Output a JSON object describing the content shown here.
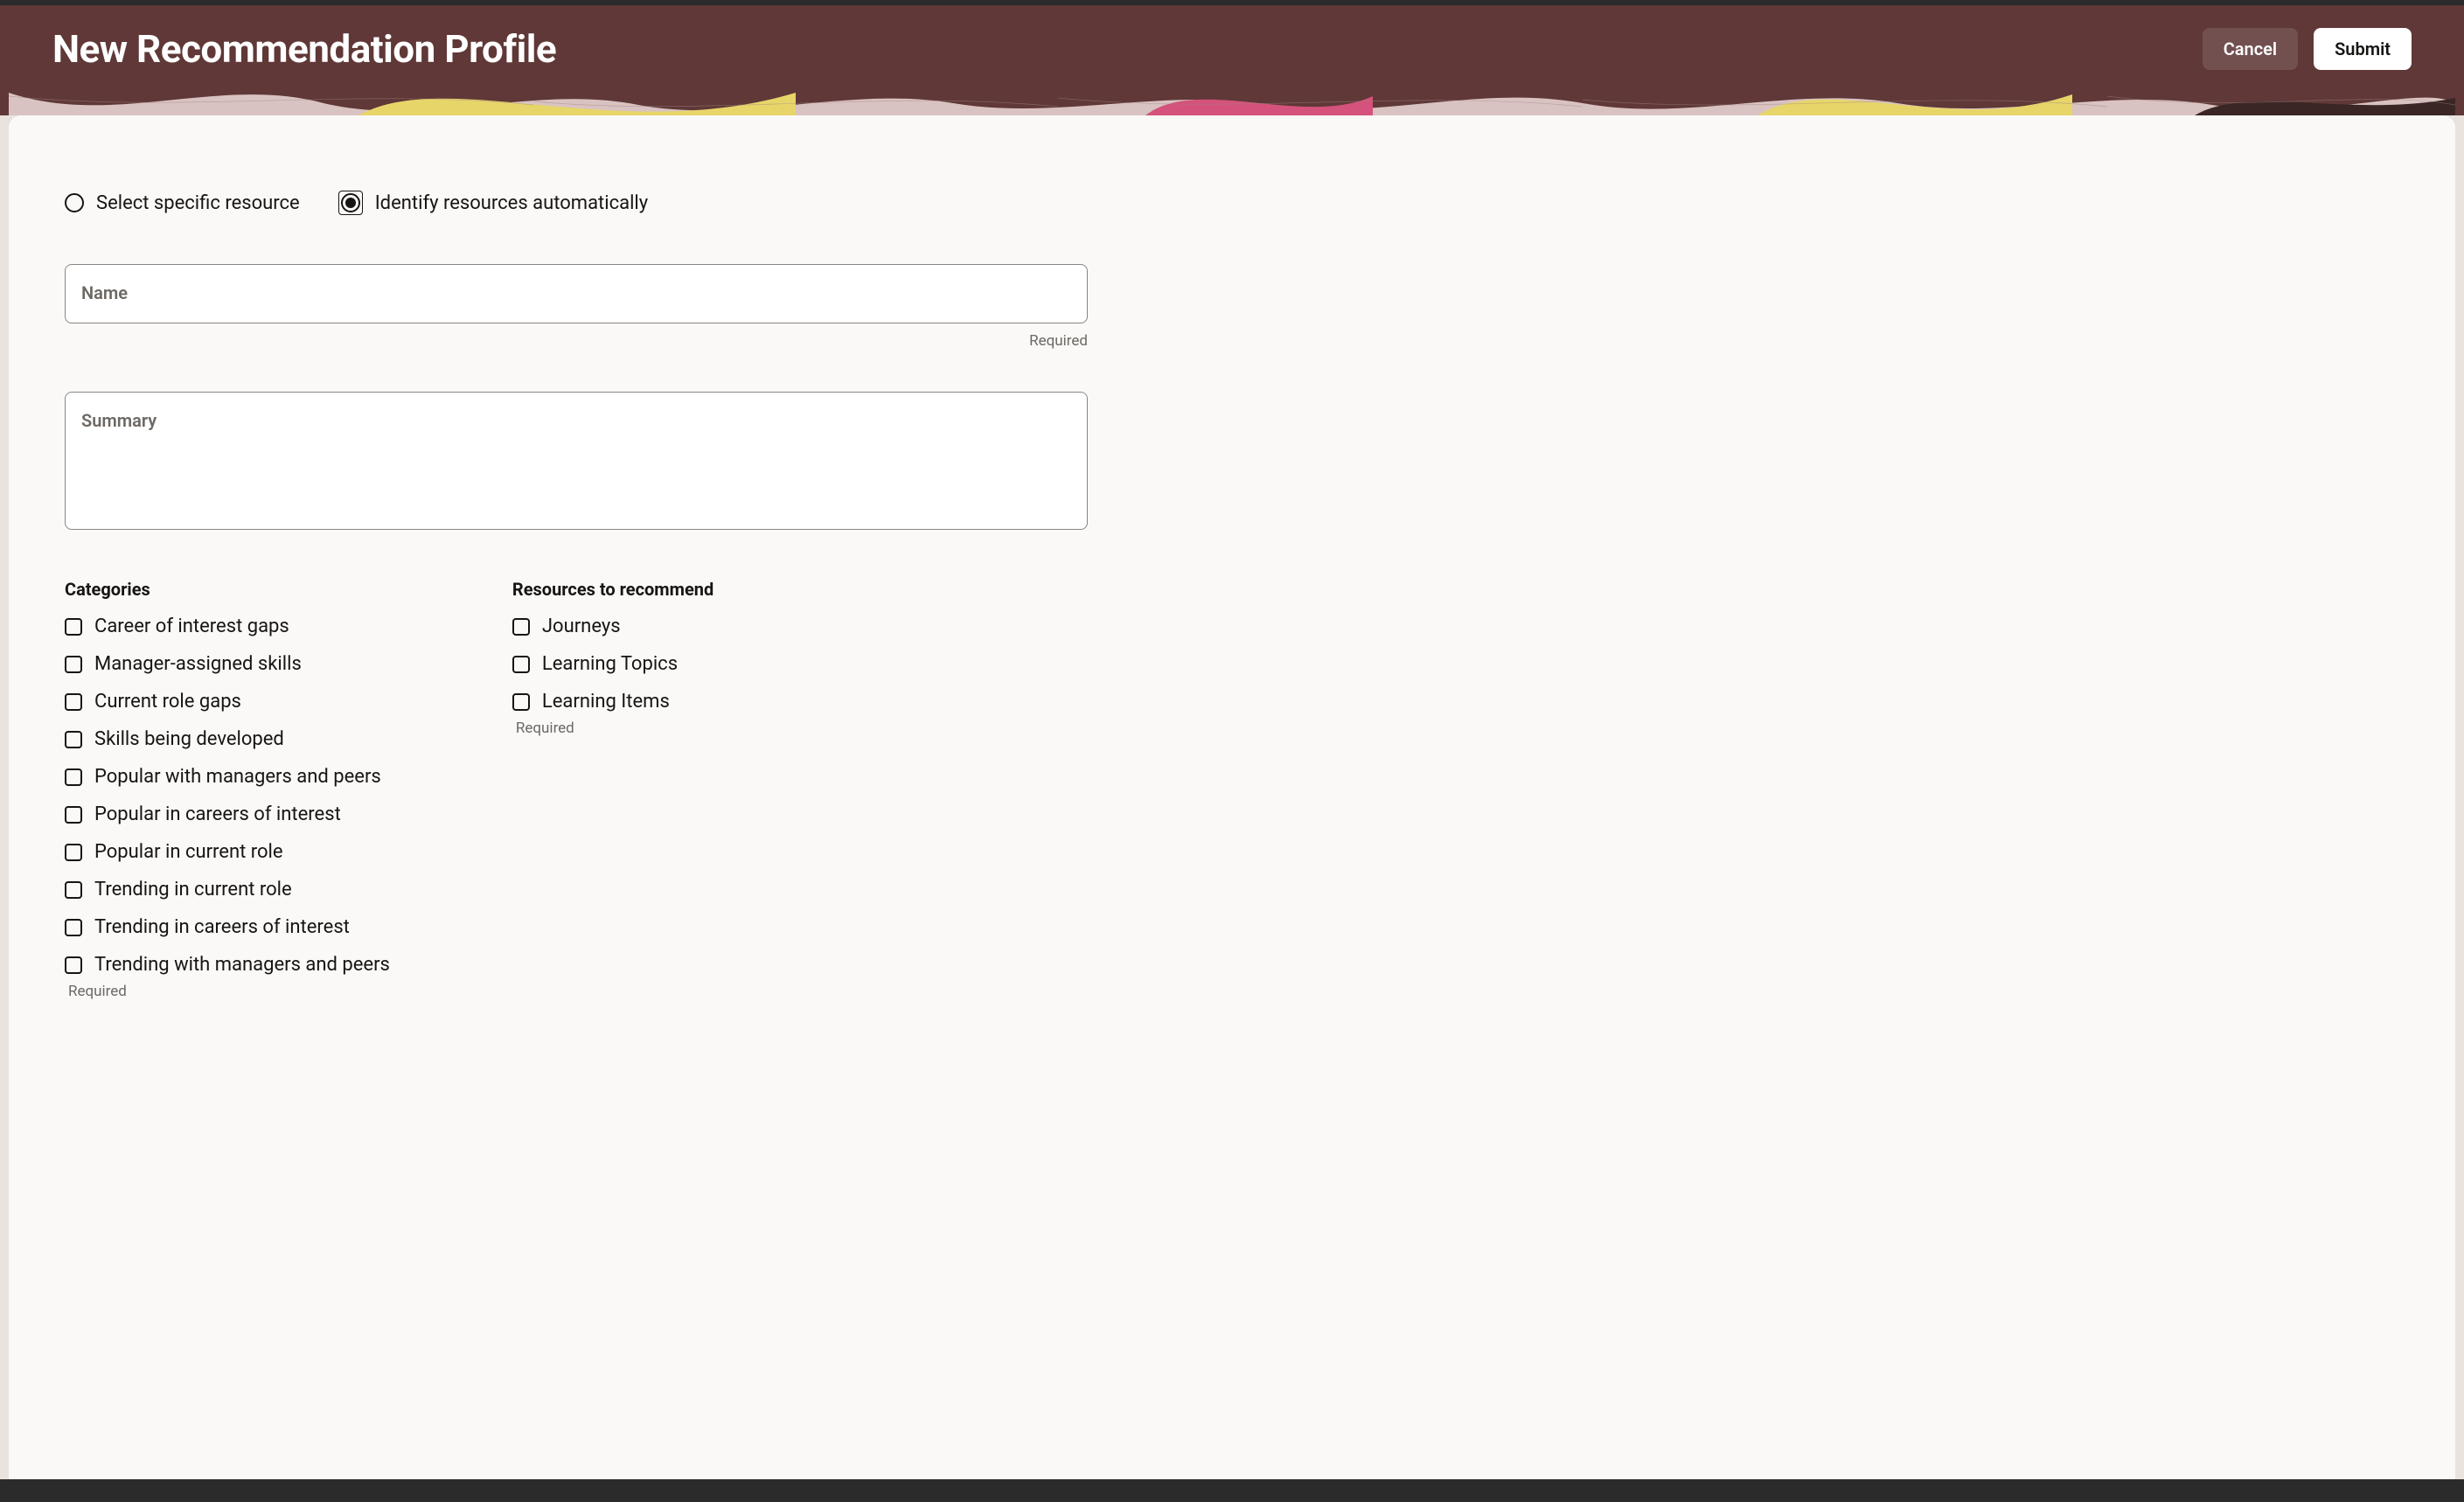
{
  "header": {
    "title": "New Recommendation Profile",
    "cancel": "Cancel",
    "submit": "Submit"
  },
  "mode": {
    "options": [
      {
        "id": "select-specific",
        "label": "Select specific resource",
        "selected": false
      },
      {
        "id": "identify-auto",
        "label": "Identify resources automatically",
        "selected": true
      }
    ]
  },
  "fields": {
    "name": {
      "label": "Name",
      "value": "",
      "hint": "Required"
    },
    "summary": {
      "label": "Summary",
      "value": ""
    }
  },
  "categories": {
    "heading": "Categories",
    "hint": "Required",
    "items": [
      "Career of interest gaps",
      "Manager-assigned skills",
      "Current role gaps",
      "Skills being developed",
      "Popular with managers and peers",
      "Popular in careers of interest",
      "Popular in current role",
      "Trending in current role",
      "Trending in careers of interest",
      "Trending with managers and peers"
    ]
  },
  "resources": {
    "heading": "Resources to recommend",
    "hint": "Required",
    "items": [
      "Journeys",
      "Learning Topics",
      "Learning Items"
    ]
  }
}
